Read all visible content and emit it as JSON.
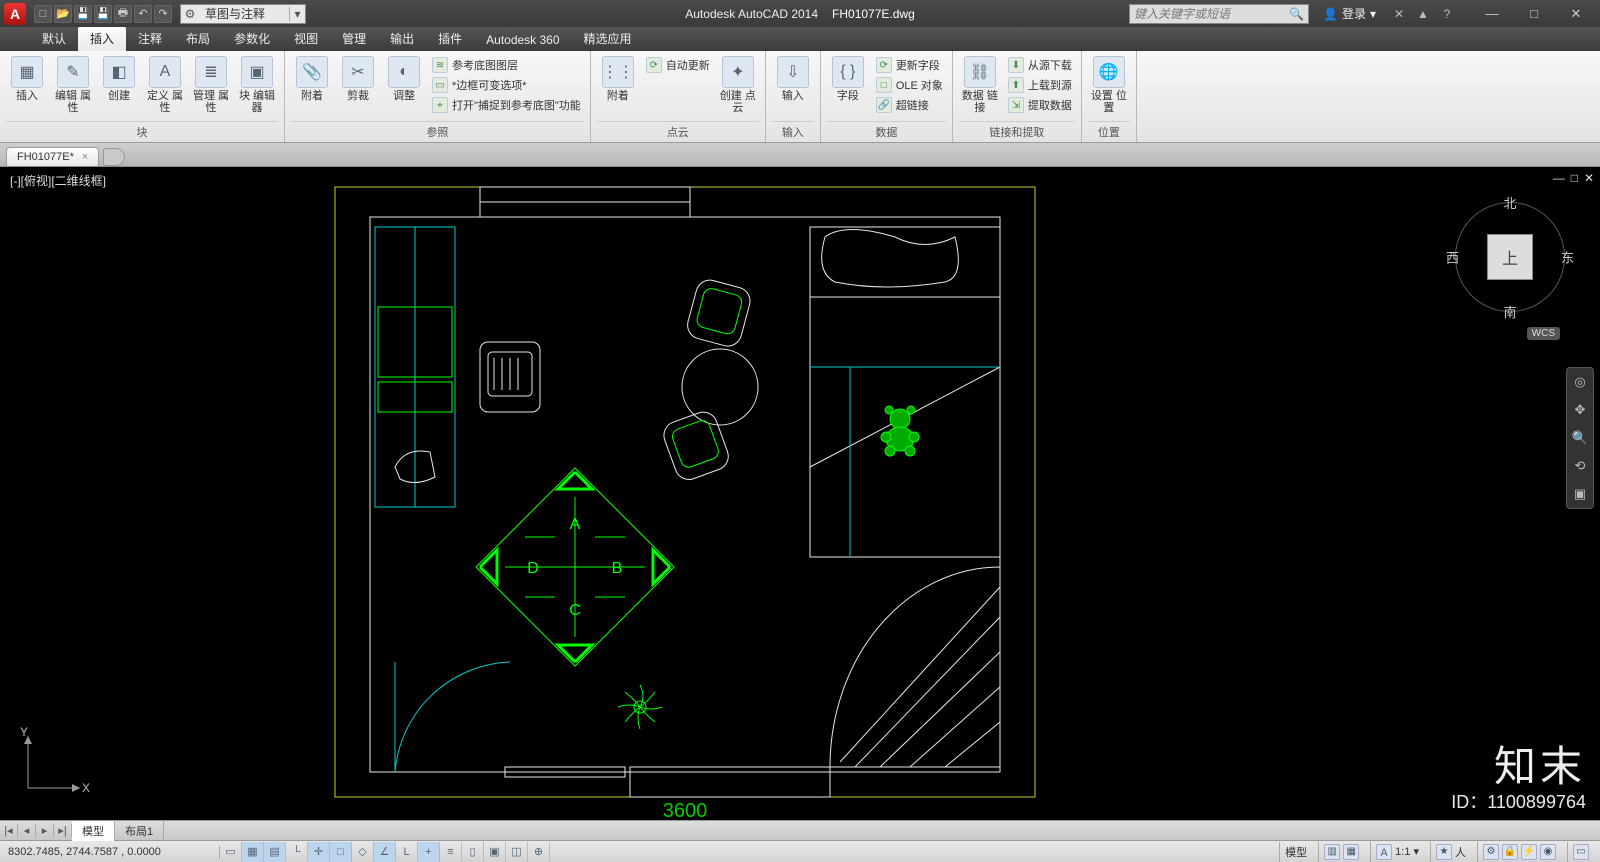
{
  "app": {
    "name": "Autodesk AutoCAD 2014",
    "file": "FH01077E.dwg"
  },
  "qat_icons": [
    "new",
    "open",
    "save",
    "saveas",
    "print",
    "undo",
    "redo"
  ],
  "workspace_selector": "草图与注释",
  "search_placeholder": "键入关键字或短语",
  "signin": {
    "label": "登录"
  },
  "window_controls": {
    "min": "—",
    "max": "□",
    "close": "✕"
  },
  "ribbon_tabs": [
    "默认",
    "插入",
    "注释",
    "布局",
    "参数化",
    "视图",
    "管理",
    "输出",
    "插件",
    "Autodesk 360",
    "精选应用"
  ],
  "active_ribbon_tab": "插入",
  "ribbon": {
    "panel_block": {
      "label": "块",
      "insert": "插入",
      "editattr": "编辑\n属性",
      "create": "创建",
      "defattr": "定义\n属性",
      "mgrattr": "管理\n属性",
      "blk": "块\n编辑器"
    },
    "panel_ref": {
      "label": "参照",
      "attach": "附着",
      "clip": "剪裁",
      "adjust": "调整",
      "s1": "参考底图图层",
      "s2": "*边框可变选项*",
      "s3": "打开\"捕捉到参考底图\"功能"
    },
    "panel_pc": {
      "label": "点云",
      "attach": "附着",
      "s1": "自动更新",
      "create": "创建\n点云"
    },
    "panel_import": {
      "label": "输入",
      "import": "输入"
    },
    "panel_data": {
      "label": "数据",
      "field": "字段",
      "s1": "更新字段",
      "s2": "OLE 对象",
      "s3": "超链接"
    },
    "panel_link": {
      "label": "链接和提取",
      "dl": "数据\n链接",
      "s1": "从源下载",
      "s2": "上载到源",
      "s3": "提取数据"
    },
    "panel_loc": {
      "label": "位置",
      "set": "设置\n位置"
    }
  },
  "file_tab": {
    "name": "FH01077E*",
    "close": "×"
  },
  "viewport_label": "[-][俯视][二维线框]",
  "viewport_controls": {
    "min": "—",
    "max": "□",
    "close": "✕"
  },
  "viewcube": {
    "n": "北",
    "s": "南",
    "e": "东",
    "w": "西",
    "face": "上",
    "wcs": "WCS"
  },
  "ucs": {
    "x": "X",
    "y": "Y"
  },
  "drawing": {
    "dim_bottom": "3600",
    "slab": {
      "A": "A",
      "B": "B",
      "C": "C",
      "D": "D"
    }
  },
  "watermark": {
    "logo": "知末",
    "id": "ID：1100899764"
  },
  "layout_tabs": {
    "nav": [
      "|◂",
      "◂",
      "▸",
      "▸|"
    ],
    "model": "模型",
    "layout1": "布局1"
  },
  "status": {
    "coords": "8302.7485, 2744.7587 , 0.0000",
    "right": {
      "model": "模型",
      "scale": "1:1",
      "anno": "人"
    }
  }
}
